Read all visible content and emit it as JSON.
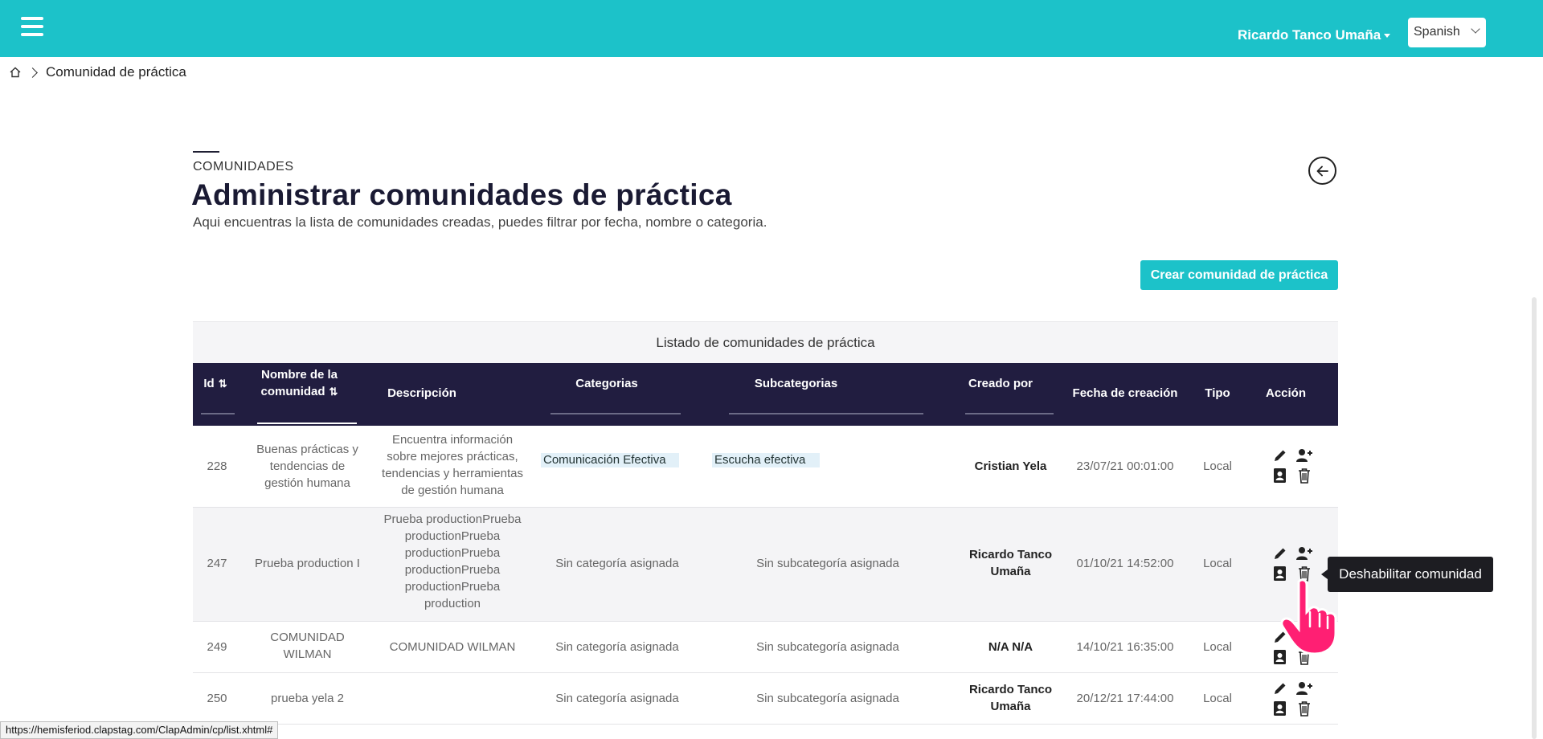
{
  "topbar": {
    "user_name": "Ricardo Tanco Umaña",
    "language": "Spanish",
    "brand_color": "#1cc2c9"
  },
  "breadcrumb": {
    "current": "Comunidad de práctica"
  },
  "header": {
    "section_label": "COMUNIDADES",
    "title": "Administrar comunidades de práctica",
    "subtitle": "Aqui encuentras la lista de comunidades creadas, puedes filtrar por fecha, nombre o categoria."
  },
  "create_button": "Crear comunidad de práctica",
  "table": {
    "caption": "Listado de comunidades de práctica",
    "header_color": "#211d40",
    "columns": {
      "id": "Id",
      "name_line1": "Nombre de la",
      "name_line2": "comunidad",
      "description": "Descripción",
      "categories": "Categorias",
      "subcategories": "Subcategorias",
      "created_by": "Creado por",
      "created_date": "Fecha de creación",
      "type": "Tipo",
      "action": "Acción"
    },
    "rows": [
      {
        "id": "228",
        "name_lines": [
          "Buenas prácticas y",
          "tendencias de",
          "gestión humana"
        ],
        "description_lines": [
          "Encuentra información",
          "sobre mejores prácticas,",
          "tendencias y herramientas",
          "de gestión humana"
        ],
        "category": "Comunicación Efectiva",
        "subcategory": "Escucha efectiva",
        "creator_lines": [
          "Cristian Yela"
        ],
        "date": "23/07/21 00:01:00",
        "type": "Local"
      },
      {
        "id": "247",
        "name_lines": [
          "Prueba production I"
        ],
        "description_lines": [
          "Prueba productionPrueba",
          "productionPrueba",
          "productionPrueba",
          "productionPrueba",
          "productionPrueba",
          "production"
        ],
        "category": "Sin categoría asignada",
        "subcategory": "Sin subcategoría asignada",
        "creator_lines": [
          "Ricardo Tanco",
          "Umaña"
        ],
        "date": "01/10/21 14:52:00",
        "type": "Local"
      },
      {
        "id": "249",
        "name_lines": [
          "COMUNIDAD",
          "WILMAN"
        ],
        "description_lines": [
          "COMUNIDAD WILMAN"
        ],
        "category": "Sin categoría asignada",
        "subcategory": "Sin subcategoría asignada",
        "creator_lines": [
          "N/A N/A"
        ],
        "date": "14/10/21 16:35:00",
        "type": "Local"
      },
      {
        "id": "250",
        "name_lines": [
          "prueba yela 2"
        ],
        "description_lines": [],
        "category": "Sin categoría asignada",
        "subcategory": "Sin subcategoría asignada",
        "creator_lines": [
          "Ricardo Tanco",
          "Umaña"
        ],
        "date": "20/12/21 17:44:00",
        "type": "Local"
      }
    ]
  },
  "tooltip": "Deshabilitar comunidad",
  "status_url": "https://hemisferiod.clapstag.com/ClapAdmin/cp/list.xhtml#"
}
